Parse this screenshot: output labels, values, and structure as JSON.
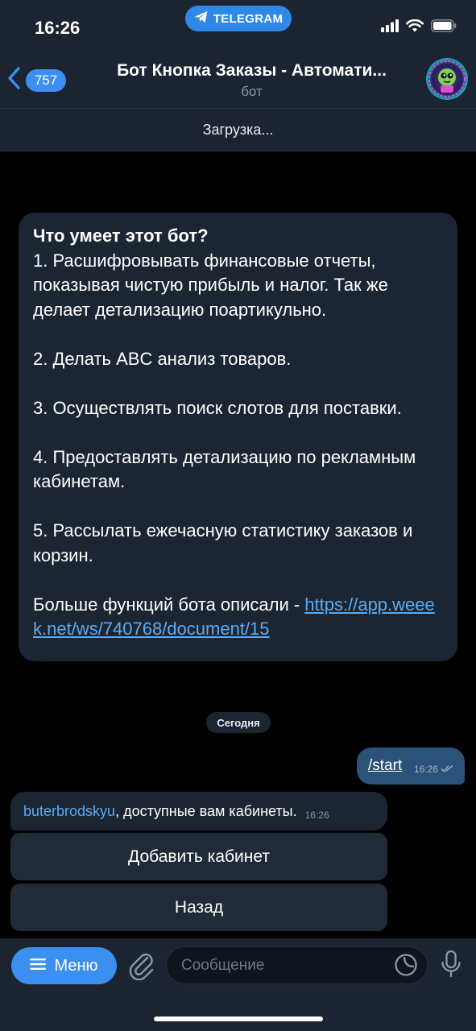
{
  "status_bar": {
    "time": "16:26",
    "app_pill": "TELEGRAM"
  },
  "header": {
    "unread_count": "757",
    "title": "Бот Кнопка Заказы - Автомати...",
    "subtitle": "бот"
  },
  "loading_text": "Загрузка...",
  "intro": {
    "title": "Что умеет этот бот?",
    "body": "1. Расшифровывать финансовые отчеты, показывая чистую прибыль и налог. Так же делает детализацию поартикульно.\n\n2. Делать ABC анализ товаров.\n\n3. Осуществлять поиск слотов для поставки.\n\n4. Предоставлять детализацию по рекламным кабинетам.\n\n5. Рассылать ежечасную статистику заказов и корзин.\n\n",
    "more_text": "Больше функций бота описали - ",
    "link": "https://app.weeek.net/ws/740768/document/15"
  },
  "date_chip": "Сегодня",
  "outgoing": {
    "text": "/start",
    "time": "16:26"
  },
  "incoming": {
    "mention": "buterbrodskyu",
    "text": ", доступные вам кабинеты.",
    "time": "16:26"
  },
  "keyboard": {
    "add_label": "Добавить кабинет",
    "back_label": "Назад"
  },
  "input_bar": {
    "menu_label": "Меню",
    "placeholder": "Сообщение"
  },
  "colors": {
    "accent": "#3b8ff0",
    "bar_bg": "#1b2430",
    "bubble_in": "#1c2632",
    "bubble_out": "#2b5278",
    "link": "#5aabf5"
  }
}
